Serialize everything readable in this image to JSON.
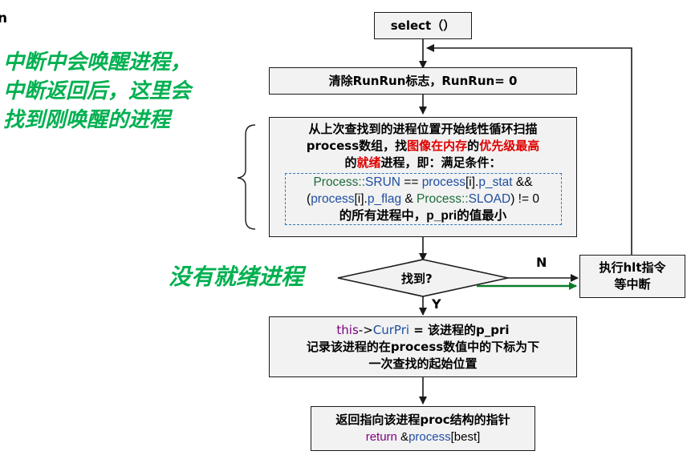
{
  "corner_letter": "n",
  "notes": {
    "wake_line1": "中断中会唤醒进程，",
    "wake_line2": "中断返回后，这里会",
    "wake_line3": "找到刚唤醒的进程",
    "no_ready": "没有就绪进程"
  },
  "select_box": {
    "text": "select（）"
  },
  "clear_box": {
    "text": "清除RunRun标志，RunRun= 0"
  },
  "scan_box": {
    "line1": "从上次查找到的进程位置开始线性循环扫描",
    "line2_a": "process数组，找",
    "line2_red": "图像在内存",
    "line2_b": "的",
    "line2_red2": "优先级最高",
    "line3_a": "的",
    "line3_red": "就绪",
    "line3_b": "进程，即：满足条件：",
    "cond1_a": "Process::",
    "cond1_b": "SRUN",
    "cond1_c": " == ",
    "cond1_d": "process",
    "cond1_e": "[i].",
    "cond1_f": "p_stat",
    "cond1_g": " &&",
    "cond2_a": "(",
    "cond2_b": "process",
    "cond2_c": "[i].",
    "cond2_d": "p_flag",
    "cond2_e": " & ",
    "cond2_f": "Process::",
    "cond2_g": "SLOAD",
    "cond2_h": ") != 0",
    "line_last": "的所有进程中，p_pri的值最小"
  },
  "decision": {
    "text": "找到?",
    "no_label": "N",
    "yes_label": "Y"
  },
  "hlt_box": {
    "line1": "执行hlt指令",
    "line2": "等中断"
  },
  "record_box": {
    "line1_a": "this",
    "line1_b": "->",
    "line1_c": "CurPri",
    "line1_d": " = 该进程的p_pri",
    "line2": "记录该进程的在process数值中的下标为下",
    "line3": "一次查找的起始位置"
  },
  "return_box": {
    "line1": "返回指向该进程proc结构的指针",
    "line2_a": "return",
    "line2_b": " &",
    "line2_c": "process",
    "line2_d": "[best]"
  },
  "colors": {
    "note_green": "#00b050",
    "keyword_purple": "#800080",
    "member_blue": "#1f4ea1",
    "enum_green": "#1f6b3a",
    "highlight_red": "#e00000",
    "dashed_blue": "#2e75b6",
    "box_fill": "#f2f2f2",
    "green_arrow": "#0a7d28"
  }
}
